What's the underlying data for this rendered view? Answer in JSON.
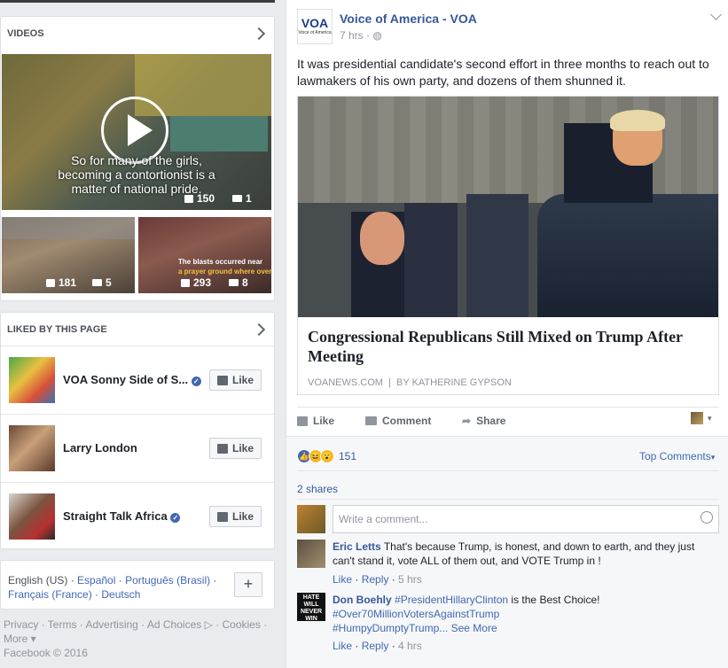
{
  "left": {
    "videos": {
      "title": "VIDEOS",
      "main": {
        "caption_line1": "So for many of the girls,",
        "caption_line2": "becoming a contortionist is a",
        "caption_line3": "matter of national pride.",
        "likes": "150",
        "comments": "1"
      },
      "thumb1": {
        "likes": "181",
        "comments": "5"
      },
      "thumb2": {
        "caption_line1": "The blasts occurred near",
        "caption_line2": "a prayer ground where over",
        "likes": "293",
        "comments": "8"
      }
    },
    "liked": {
      "title": "LIKED BY THIS PAGE",
      "like_label": "Like",
      "pages": [
        {
          "name": "VOA Sonny Side of S..."
        },
        {
          "name": "Larry London"
        },
        {
          "name": "Straight Talk Africa"
        }
      ]
    },
    "languages": {
      "items": [
        "English (US)",
        "Español",
        "Português (Brasil)",
        "Français (France)",
        "Deutsch"
      ],
      "plus": "+"
    },
    "footer": {
      "links": [
        "Privacy",
        "Terms",
        "Advertising",
        "Ad Choices",
        "Cookies",
        "More"
      ],
      "copyright": "Facebook © 2016"
    }
  },
  "post": {
    "author": "Voice of America - VOA",
    "time": "7 hrs",
    "logo_text": "VOA",
    "logo_sub": "Voice of America",
    "text": "It was presidential candidate's second effort in three months to reach out to lawmakers of his own party, and dozens of them shunned it.",
    "article": {
      "title": "Congressional Republicans Still Mixed on Trump After Meeting",
      "source": "VOANEWS.COM",
      "byline": "BY KATHERINE GYPSON"
    },
    "actions": {
      "like": "Like",
      "comment": "Comment",
      "share": "Share"
    },
    "reactions_count": "151",
    "top_comments": "Top Comments",
    "shares": "2 shares",
    "comment_placeholder": "Write a comment...",
    "comments": [
      {
        "author": "Eric Letts",
        "text": "That's because Trump, is honest, and down to earth, and they just can't stand it, vote ALL of them out, and VOTE Trump in !",
        "like": "Like",
        "reply": "Reply",
        "time": "5 hrs"
      },
      {
        "author": "Don Boehly",
        "line1": "#PresidentHillaryClinton",
        "line1_rest": "is the Best Choice!",
        "line2": "#Over70MillionVotersAgainstTrump",
        "line3": "#HumpyDumptyTrump...",
        "see_more": "See More",
        "like": "Like",
        "reply": "Reply",
        "time": "4 hrs",
        "avatar_text": "HATE WILL NEVER WIN"
      }
    ]
  }
}
